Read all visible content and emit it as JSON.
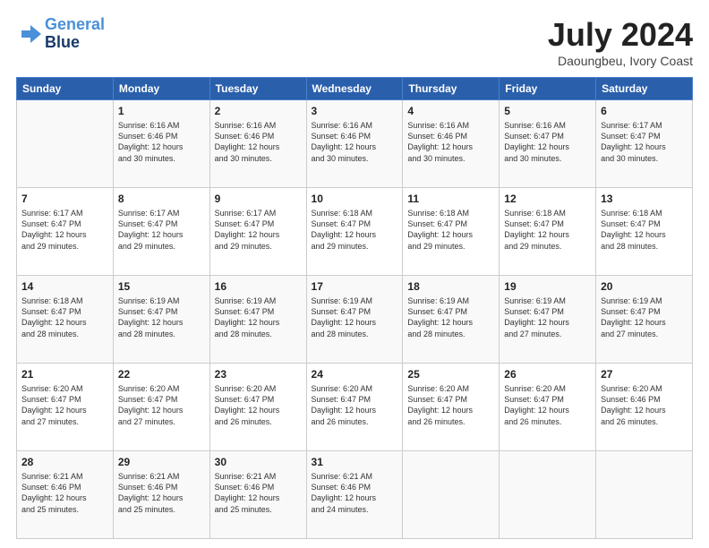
{
  "logo": {
    "line1": "General",
    "line2": "Blue"
  },
  "title": "July 2024",
  "location": "Daoungbeu, Ivory Coast",
  "weekdays": [
    "Sunday",
    "Monday",
    "Tuesday",
    "Wednesday",
    "Thursday",
    "Friday",
    "Saturday"
  ],
  "weeks": [
    [
      {
        "day": "",
        "lines": []
      },
      {
        "day": "1",
        "lines": [
          "Sunrise: 6:16 AM",
          "Sunset: 6:46 PM",
          "Daylight: 12 hours",
          "and 30 minutes."
        ]
      },
      {
        "day": "2",
        "lines": [
          "Sunrise: 6:16 AM",
          "Sunset: 6:46 PM",
          "Daylight: 12 hours",
          "and 30 minutes."
        ]
      },
      {
        "day": "3",
        "lines": [
          "Sunrise: 6:16 AM",
          "Sunset: 6:46 PM",
          "Daylight: 12 hours",
          "and 30 minutes."
        ]
      },
      {
        "day": "4",
        "lines": [
          "Sunrise: 6:16 AM",
          "Sunset: 6:46 PM",
          "Daylight: 12 hours",
          "and 30 minutes."
        ]
      },
      {
        "day": "5",
        "lines": [
          "Sunrise: 6:16 AM",
          "Sunset: 6:47 PM",
          "Daylight: 12 hours",
          "and 30 minutes."
        ]
      },
      {
        "day": "6",
        "lines": [
          "Sunrise: 6:17 AM",
          "Sunset: 6:47 PM",
          "Daylight: 12 hours",
          "and 30 minutes."
        ]
      }
    ],
    [
      {
        "day": "7",
        "lines": [
          "Sunrise: 6:17 AM",
          "Sunset: 6:47 PM",
          "Daylight: 12 hours",
          "and 29 minutes."
        ]
      },
      {
        "day": "8",
        "lines": [
          "Sunrise: 6:17 AM",
          "Sunset: 6:47 PM",
          "Daylight: 12 hours",
          "and 29 minutes."
        ]
      },
      {
        "day": "9",
        "lines": [
          "Sunrise: 6:17 AM",
          "Sunset: 6:47 PM",
          "Daylight: 12 hours",
          "and 29 minutes."
        ]
      },
      {
        "day": "10",
        "lines": [
          "Sunrise: 6:18 AM",
          "Sunset: 6:47 PM",
          "Daylight: 12 hours",
          "and 29 minutes."
        ]
      },
      {
        "day": "11",
        "lines": [
          "Sunrise: 6:18 AM",
          "Sunset: 6:47 PM",
          "Daylight: 12 hours",
          "and 29 minutes."
        ]
      },
      {
        "day": "12",
        "lines": [
          "Sunrise: 6:18 AM",
          "Sunset: 6:47 PM",
          "Daylight: 12 hours",
          "and 29 minutes."
        ]
      },
      {
        "day": "13",
        "lines": [
          "Sunrise: 6:18 AM",
          "Sunset: 6:47 PM",
          "Daylight: 12 hours",
          "and 28 minutes."
        ]
      }
    ],
    [
      {
        "day": "14",
        "lines": [
          "Sunrise: 6:18 AM",
          "Sunset: 6:47 PM",
          "Daylight: 12 hours",
          "and 28 minutes."
        ]
      },
      {
        "day": "15",
        "lines": [
          "Sunrise: 6:19 AM",
          "Sunset: 6:47 PM",
          "Daylight: 12 hours",
          "and 28 minutes."
        ]
      },
      {
        "day": "16",
        "lines": [
          "Sunrise: 6:19 AM",
          "Sunset: 6:47 PM",
          "Daylight: 12 hours",
          "and 28 minutes."
        ]
      },
      {
        "day": "17",
        "lines": [
          "Sunrise: 6:19 AM",
          "Sunset: 6:47 PM",
          "Daylight: 12 hours",
          "and 28 minutes."
        ]
      },
      {
        "day": "18",
        "lines": [
          "Sunrise: 6:19 AM",
          "Sunset: 6:47 PM",
          "Daylight: 12 hours",
          "and 28 minutes."
        ]
      },
      {
        "day": "19",
        "lines": [
          "Sunrise: 6:19 AM",
          "Sunset: 6:47 PM",
          "Daylight: 12 hours",
          "and 27 minutes."
        ]
      },
      {
        "day": "20",
        "lines": [
          "Sunrise: 6:19 AM",
          "Sunset: 6:47 PM",
          "Daylight: 12 hours",
          "and 27 minutes."
        ]
      }
    ],
    [
      {
        "day": "21",
        "lines": [
          "Sunrise: 6:20 AM",
          "Sunset: 6:47 PM",
          "Daylight: 12 hours",
          "and 27 minutes."
        ]
      },
      {
        "day": "22",
        "lines": [
          "Sunrise: 6:20 AM",
          "Sunset: 6:47 PM",
          "Daylight: 12 hours",
          "and 27 minutes."
        ]
      },
      {
        "day": "23",
        "lines": [
          "Sunrise: 6:20 AM",
          "Sunset: 6:47 PM",
          "Daylight: 12 hours",
          "and 26 minutes."
        ]
      },
      {
        "day": "24",
        "lines": [
          "Sunrise: 6:20 AM",
          "Sunset: 6:47 PM",
          "Daylight: 12 hours",
          "and 26 minutes."
        ]
      },
      {
        "day": "25",
        "lines": [
          "Sunrise: 6:20 AM",
          "Sunset: 6:47 PM",
          "Daylight: 12 hours",
          "and 26 minutes."
        ]
      },
      {
        "day": "26",
        "lines": [
          "Sunrise: 6:20 AM",
          "Sunset: 6:47 PM",
          "Daylight: 12 hours",
          "and 26 minutes."
        ]
      },
      {
        "day": "27",
        "lines": [
          "Sunrise: 6:20 AM",
          "Sunset: 6:46 PM",
          "Daylight: 12 hours",
          "and 26 minutes."
        ]
      }
    ],
    [
      {
        "day": "28",
        "lines": [
          "Sunrise: 6:21 AM",
          "Sunset: 6:46 PM",
          "Daylight: 12 hours",
          "and 25 minutes."
        ]
      },
      {
        "day": "29",
        "lines": [
          "Sunrise: 6:21 AM",
          "Sunset: 6:46 PM",
          "Daylight: 12 hours",
          "and 25 minutes."
        ]
      },
      {
        "day": "30",
        "lines": [
          "Sunrise: 6:21 AM",
          "Sunset: 6:46 PM",
          "Daylight: 12 hours",
          "and 25 minutes."
        ]
      },
      {
        "day": "31",
        "lines": [
          "Sunrise: 6:21 AM",
          "Sunset: 6:46 PM",
          "Daylight: 12 hours",
          "and 24 minutes."
        ]
      },
      {
        "day": "",
        "lines": []
      },
      {
        "day": "",
        "lines": []
      },
      {
        "day": "",
        "lines": []
      }
    ]
  ]
}
